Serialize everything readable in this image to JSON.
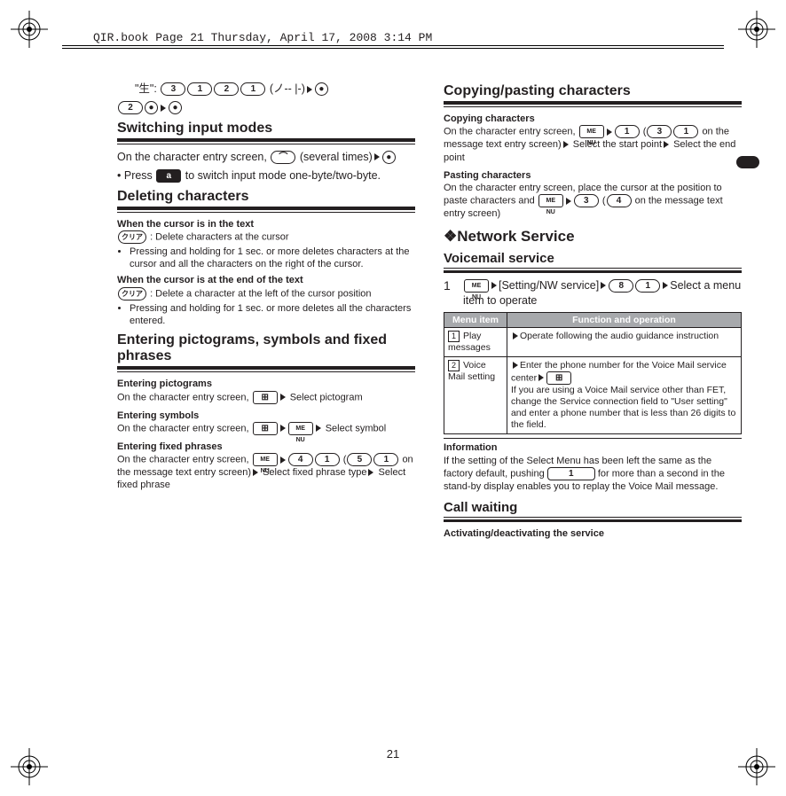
{
  "header": "QIR.book  Page 21  Thursday, April 17, 2008  3:14 PM",
  "page_number": "21",
  "col1": {
    "example_prefix": "\"生\":",
    "example_keys": [
      "3",
      "1",
      "2",
      "1"
    ],
    "example_paren": "(ノ-- |-)",
    "example_tail_keys": [
      "2",
      "◉"
    ],
    "title1": "Switching input modes",
    "body1a": "On the character entry screen,",
    "body1b": "(several times)",
    "bullet1": "Press",
    "bullet1b": "to switch input mode one-byte/two-byte.",
    "title2": "Deleting characters",
    "h2a": "When the cursor is in the text",
    "clr_key": "クリア",
    "desc2a": ": Delete characters at the cursor",
    "sub2a": "Pressing and holding for 1 sec. or more deletes characters at the cursor and all the characters on the right of the cursor.",
    "h2b": "When the cursor is at the end of the text",
    "desc2b": ": Delete a character at the left of the cursor position",
    "sub2b": "Pressing and holding for 1 sec. or more deletes all the characters entered.",
    "title3": "Entering pictograms, symbols and fixed phrases",
    "h3a": "Entering pictograms",
    "body3a": "On the character entry screen,",
    "body3a_tail": "Select pictogram",
    "h3b": "Entering symbols",
    "body3b": "On the character entry screen,",
    "body3b_tail": "Select symbol",
    "h3c": "Entering fixed phrases",
    "body3c": "On the character entry screen,",
    "body3c_keys": [
      "4",
      "1"
    ],
    "body3c_paren_keys": [
      "5",
      "1"
    ],
    "body3c_paren_tail": "on the message text entry screen)",
    "body3c_tail": "Select fixed phrase type",
    "body3c_tail2": "Select fixed phrase"
  },
  "col2": {
    "title1": "Copying/pasting characters",
    "h1a": "Copying characters",
    "body1a": "On the character entry screen,",
    "body1a_key2": "1",
    "body1a_paren_keys": [
      "3",
      "1"
    ],
    "body1a_paren_tail": "on the message text entry screen)",
    "body1a_tail1": "Select the start point",
    "body1a_tail2": "Select the end point",
    "h1b": "Pasting characters",
    "body1b": "On the character entry screen, place the cursor at the position to paste characters and",
    "body1b_key2": "3",
    "body1b_paren_key": "4",
    "body1b_paren_tail": "on the message text entry screen)",
    "diamond": "❖",
    "title2": "Network Service",
    "subtitle2": "Voicemail service",
    "step1_num": "1",
    "step1a": "[Setting/NW service]",
    "step1_keys": [
      "8",
      "1"
    ],
    "step1b": "Select a menu item to operate",
    "tbl_h1": "Menu item",
    "tbl_h2": "Function and operation",
    "row1_num": "1",
    "row1_a": "Play messages",
    "row1_b": "Operate following the audio guidance instruction",
    "row2_num": "2",
    "row2_a": "Voice Mail setting",
    "row2_b1": "Enter the phone number for the Voice Mail service center",
    "row2_b2": "If you are using a Voice Mail service other than FET, change the Service connection field to \"User setting\" and enter a phone number that is less than 26 digits to the field.",
    "info_h": "Information",
    "info_body1": "If the setting of the Select Menu has been left the same as the factory default, pushing",
    "info_key": "1",
    "info_body2": "for more than a second in the stand-by display enables you to replay the Voice Mail message.",
    "subtitle3": "Call waiting",
    "h3a": "Activating/deactivating the service"
  }
}
